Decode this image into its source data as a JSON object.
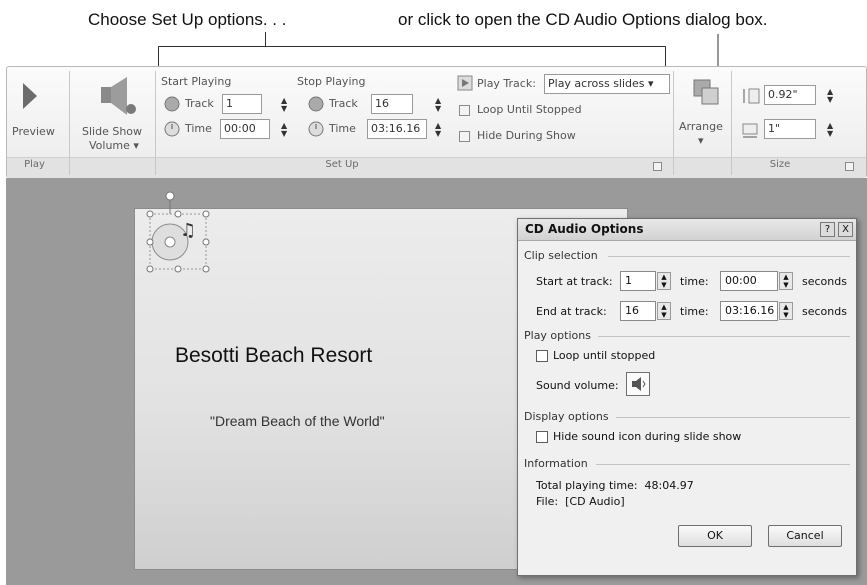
{
  "callouts": {
    "left": "Choose Set Up options. . .",
    "right": "or click to open the CD Audio Options dialog box."
  },
  "ribbon": {
    "play_group": {
      "preview_label": "Preview",
      "group_label": "Play"
    },
    "volume": {
      "label_line1": "Slide Show",
      "label_line2": "Volume"
    },
    "setup": {
      "group_label": "Set Up",
      "start_playing": {
        "heading": "Start Playing",
        "track_label": "Track",
        "track_value": "1",
        "time_label": "Time",
        "time_value": "00:00"
      },
      "stop_playing": {
        "heading": "Stop Playing",
        "track_label": "Track",
        "track_value": "16",
        "time_label": "Time",
        "time_value": "03:16.16"
      },
      "play_track_label": "Play Track:",
      "play_track_value": "Play across slides",
      "loop_label": "Loop Until Stopped",
      "hide_label": "Hide During Show"
    },
    "arrange_label": "Arrange",
    "size": {
      "group_label": "Size",
      "height_value": "0.92\"",
      "width_value": "1\""
    }
  },
  "slide": {
    "title": "Besotti Beach Resort",
    "subtitle": "\"Dream Beach of the World\""
  },
  "dialog": {
    "title": "CD Audio Options",
    "help_btn": "?",
    "close_btn": "X",
    "clip_selection": {
      "heading": "Clip selection",
      "start_label": "Start at track:",
      "start_track": "1",
      "start_time_label": "time:",
      "start_time": "00:00",
      "end_label": "End at track:",
      "end_track": "16",
      "end_time_label": "time:",
      "end_time": "03:16.16",
      "seconds_label": "seconds"
    },
    "play_options": {
      "heading": "Play options",
      "loop_label": "Loop until stopped",
      "volume_label": "Sound volume:"
    },
    "display_options": {
      "heading": "Display options",
      "hide_label": "Hide sound icon during slide show"
    },
    "information": {
      "heading": "Information",
      "total_label": "Total playing time:",
      "total_value": "48:04.97",
      "file_label": "File:",
      "file_value": "[CD Audio]"
    },
    "ok_label": "OK",
    "cancel_label": "Cancel"
  }
}
